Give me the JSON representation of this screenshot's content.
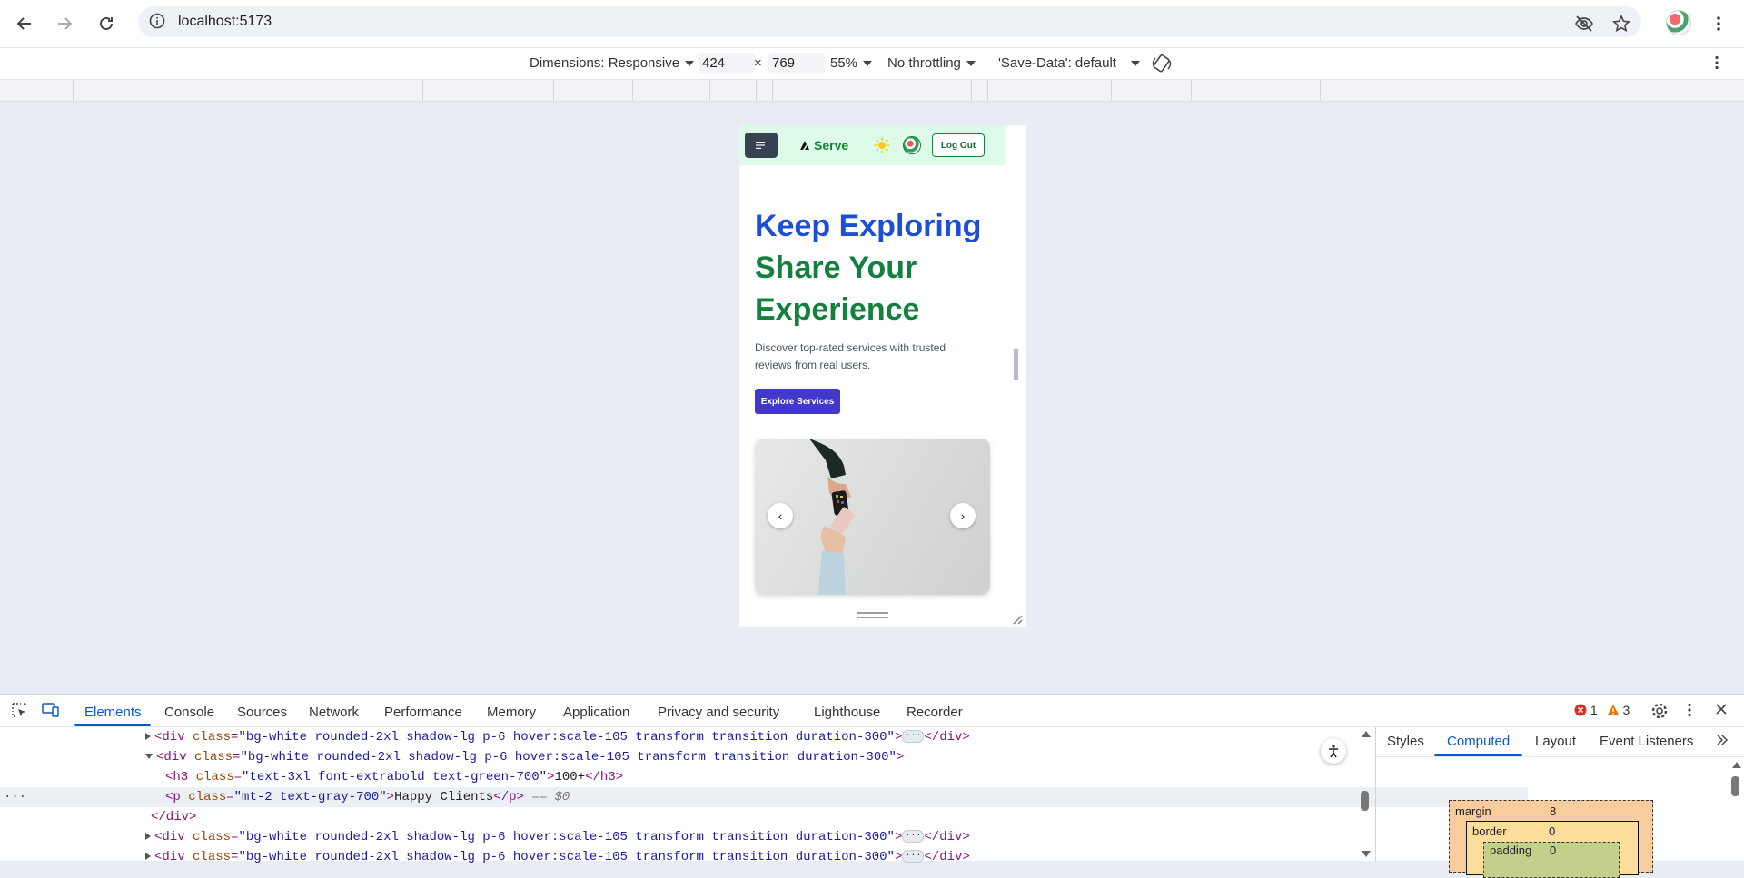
{
  "browser": {
    "url": "localhost:5173",
    "icons": {
      "back": "back-arrow-icon",
      "forward": "forward-arrow-icon",
      "reload": "reload-icon",
      "site_info": "info-icon",
      "eye_off": "eye-off-icon",
      "bookmark": "star-icon",
      "menu": "kebab-menu-icon"
    }
  },
  "device_toolbar": {
    "dimensions_label": "Dimensions: Responsive",
    "width": "424",
    "times": "×",
    "height": "769",
    "zoom": "55%",
    "throttling": "No throttling",
    "save_data": "'Save-Data': default"
  },
  "app": {
    "brand": "Serve",
    "logout_label": "Log Out",
    "hero": {
      "line1": "Keep Exploring",
      "line2": "Share Your",
      "line3": "Experience",
      "description": "Discover top-rated services with trusted reviews from real users.",
      "cta": "Explore Services"
    },
    "carousel": {
      "prev": "‹",
      "next": "›"
    },
    "colors": {
      "nav_bg": "#dcfce7",
      "heading_blue": "#1d4ed8",
      "heading_green": "#15803d",
      "cta_bg": "#4338ca"
    }
  },
  "devtools": {
    "tabs": [
      "Elements",
      "Console",
      "Sources",
      "Network",
      "Performance",
      "Memory",
      "Application",
      "Privacy and security",
      "Lighthouse",
      "Recorder"
    ],
    "active_tab": "Elements",
    "errors": "1",
    "warnings": "3",
    "dom_lines": [
      {
        "open": "<div ",
        "attr": "class",
        "val": "\"bg-white rounded-2xl shadow-lg p-6 hover:scale-105 transform transition duration-300\"",
        "close": ">",
        "tail": "</div>"
      },
      {
        "open": "<div ",
        "attr": "class",
        "val": "\"bg-white rounded-2xl shadow-lg p-6 hover:scale-105 transform transition duration-300\"",
        "close": ">"
      },
      {
        "open": "<h3 ",
        "attr": "class",
        "val": "\"text-3xl font-extrabold text-green-700\"",
        "close": ">",
        "text": "100+",
        "end": "</h3>"
      },
      {
        "open": "<p ",
        "attr": "class",
        "val": "\"mt-2 text-gray-700\"",
        "close": ">",
        "text": "Happy Clients",
        "end": "</p>",
        "marker": "== $0"
      },
      {
        "end": "</div>"
      },
      {
        "open": "<div ",
        "attr": "class",
        "val": "\"bg-white rounded-2xl shadow-lg p-6 hover:scale-105 transform transition duration-300\"",
        "close": ">",
        "tail": "</div>"
      },
      {
        "open": "<div ",
        "attr": "class",
        "val": "\"bg-white rounded-2xl shadow-lg p-6 hover:scale-105 transform transition duration-300\"",
        "close": ">",
        "tail": "</div>"
      }
    ],
    "side_tabs": [
      "Styles",
      "Computed",
      "Layout",
      "Event Listeners"
    ],
    "side_active": "Computed",
    "box_model": {
      "margin_label": "margin",
      "margin_value": "8",
      "border_label": "border",
      "border_value": "0",
      "padding_label": "padding",
      "padding_value": "0"
    }
  }
}
